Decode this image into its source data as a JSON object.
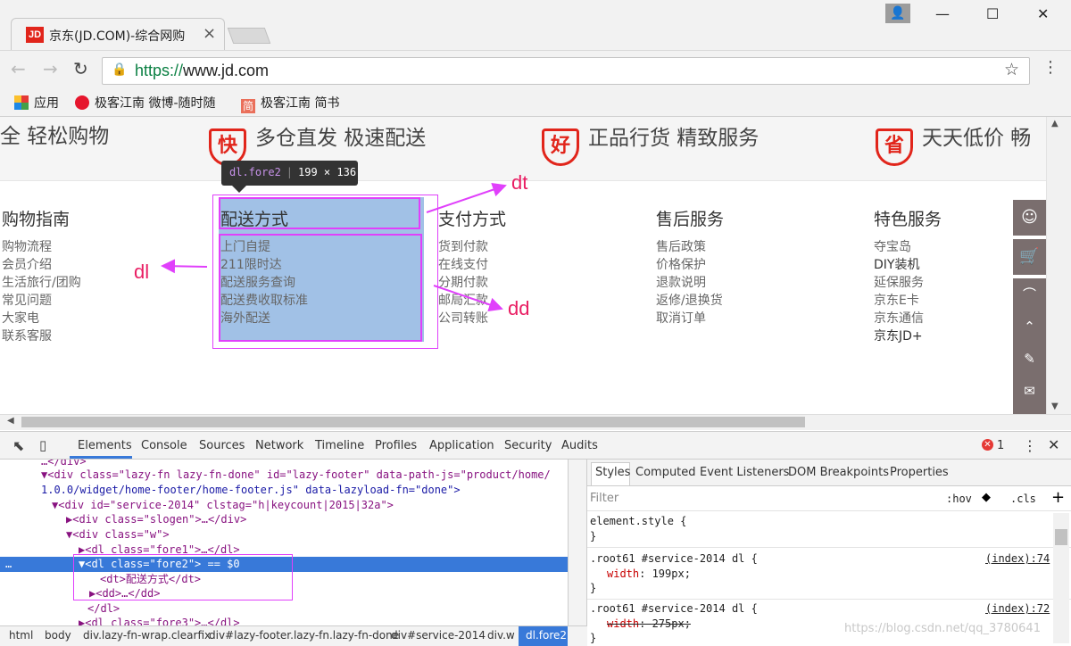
{
  "browser": {
    "tab_title": "京东(JD.COM)-综合网购",
    "favicon_text": "JD",
    "url_scheme": "https://",
    "url_host": "www.jd.com",
    "bookmarks": [
      "应用",
      "极客江南 微博-随时随",
      "极客江南 简书"
    ],
    "bookmark_jian_icon": "简"
  },
  "page": {
    "slogans": [
      {
        "badge": "",
        "text": "全  轻松购物"
      },
      {
        "badge": "快",
        "text": "多仓直发  极速配送"
      },
      {
        "badge": "好",
        "text": "正品行货  精致服务"
      },
      {
        "badge": "省",
        "text": "天天低价  畅"
      }
    ],
    "columns": [
      {
        "title": "购物指南",
        "items": [
          "购物流程",
          "会员介绍",
          "生活旅行/团购",
          "常见问题",
          "大家电",
          "联系客服"
        ]
      },
      {
        "title": "配送方式",
        "items": [
          "上门自提",
          "211限时达",
          "配送服务查询",
          "配送费收取标准",
          "海外配送"
        ]
      },
      {
        "title": "支付方式",
        "items": [
          "货到付款",
          "在线支付",
          "分期付款",
          "邮局汇款",
          "公司转账"
        ]
      },
      {
        "title": "售后服务",
        "items": [
          "售后政策",
          "价格保护",
          "退款说明",
          "返修/退换货",
          "取消订单"
        ]
      },
      {
        "title": "特色服务",
        "items": [
          "夺宝岛",
          "DIY装机",
          "延保服务",
          "京东E卡",
          "京东通信",
          "京东JD+"
        ]
      }
    ],
    "tooltip": {
      "tag": "dl.fore2",
      "size": "199 × 136"
    },
    "annotations": {
      "dt": "dt",
      "dd": "dd",
      "dl": "dl"
    }
  },
  "devtools": {
    "tabs": [
      "Elements",
      "Console",
      "Sources",
      "Network",
      "Timeline",
      "Profiles",
      "Application",
      "Security",
      "Audits"
    ],
    "error_count": "1",
    "dom_lines": [
      {
        "text": "…</div>"
      },
      {
        "text": "▼<div class=\"lazy-fn lazy-fn-done\" id=\"lazy-footer\" data-path-js=\"product/home/"
      },
      {
        "text": "1.0.0/widget/home-footer/home-footer.js\" data-lazyload-fn=\"done\">"
      },
      {
        "text": "▼<div id=\"service-2014\" clstag=\"h|keycount|2015|32a\">"
      },
      {
        "text": "▶<div class=\"slogen\">…</div>"
      },
      {
        "text": "▼<div class=\"w\">"
      },
      {
        "text": "▶<dl class=\"fore1\">…</dl>"
      },
      {
        "text": "▼<dl class=\"fore2\"> == $0"
      },
      {
        "text": "<dt>配送方式</dt>"
      },
      {
        "text": "▶<dd>…</dd>"
      },
      {
        "text": "</dl>"
      },
      {
        "text": "▶<dl class=\"fore3\">…</dl>"
      }
    ],
    "styles_tabs": [
      "Styles",
      "Computed",
      "Event Listeners",
      "DOM Breakpoints",
      "Properties"
    ],
    "filter_placeholder": "Filter",
    "hov": ":hov",
    "cls": ".cls",
    "rules": [
      {
        "selector": "element.style {",
        "close": "}",
        "props": []
      },
      {
        "selector": ".root61 #service-2014 dl {",
        "link": "(index):74",
        "props": [
          {
            "name": "width",
            "value": "199px;"
          }
        ],
        "close": "}"
      },
      {
        "selector": ".root61 #service-2014 dl {",
        "link": "(index):72",
        "props": [
          {
            "name": "width",
            "value": "275px;"
          }
        ],
        "close": "}"
      }
    ],
    "breadcrumbs": [
      "html",
      "body",
      "div.lazy-fn-wrap.clearfix",
      "div#lazy-footer.lazy-fn.lazy-fn-done",
      "div#service-2014",
      "div.w",
      "dl.fore2"
    ],
    "ellipsis": "…"
  },
  "watermark": "https://blog.csdn.net/qq_3780641"
}
